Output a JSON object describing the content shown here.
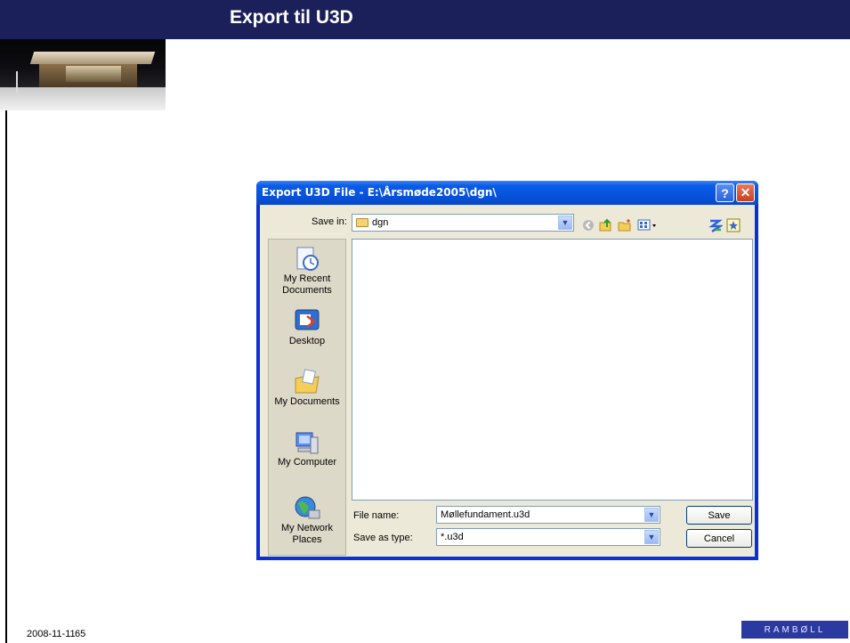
{
  "slide": {
    "title": "Export til U3D",
    "footer_date": "2008-11-11",
    "footer_page": "65",
    "footer_logo": "RAMBØLL",
    "image_alt": "building model photo"
  },
  "dialog": {
    "title": "Export U3D File - E:\\Årsmøde2005\\dgn\\",
    "help_label": "?",
    "close_label": "✕",
    "save_in_label": "Save in:",
    "save_in_value": "dgn",
    "toolbar": {
      "back_icon": "back-arrow-icon",
      "up_icon": "up-folder-icon",
      "new_folder_icon": "new-folder-icon",
      "views_icon": "views-menu-icon",
      "extra1_icon": "network-icon",
      "extra2_icon": "favorites-icon"
    },
    "places": [
      {
        "label": "My Recent Documents",
        "icon": "recent-documents-icon"
      },
      {
        "label": "Desktop",
        "icon": "desktop-icon"
      },
      {
        "label": "My Documents",
        "icon": "my-documents-icon"
      },
      {
        "label": "My Computer",
        "icon": "my-computer-icon"
      },
      {
        "label": "My Network Places",
        "icon": "network-places-icon"
      }
    ],
    "file_name_label": "File name:",
    "file_name_value": "Møllefundament.u3d",
    "save_as_type_label": "Save as type:",
    "save_as_type_value": "*.u3d",
    "save_button": "Save",
    "cancel_button": "Cancel"
  },
  "colors": {
    "slide_header": "#1b1f5a",
    "dialog_frame": "#0831d9",
    "dialog_client": "#ece9d8",
    "logo_bg": "#2b3aa0"
  }
}
